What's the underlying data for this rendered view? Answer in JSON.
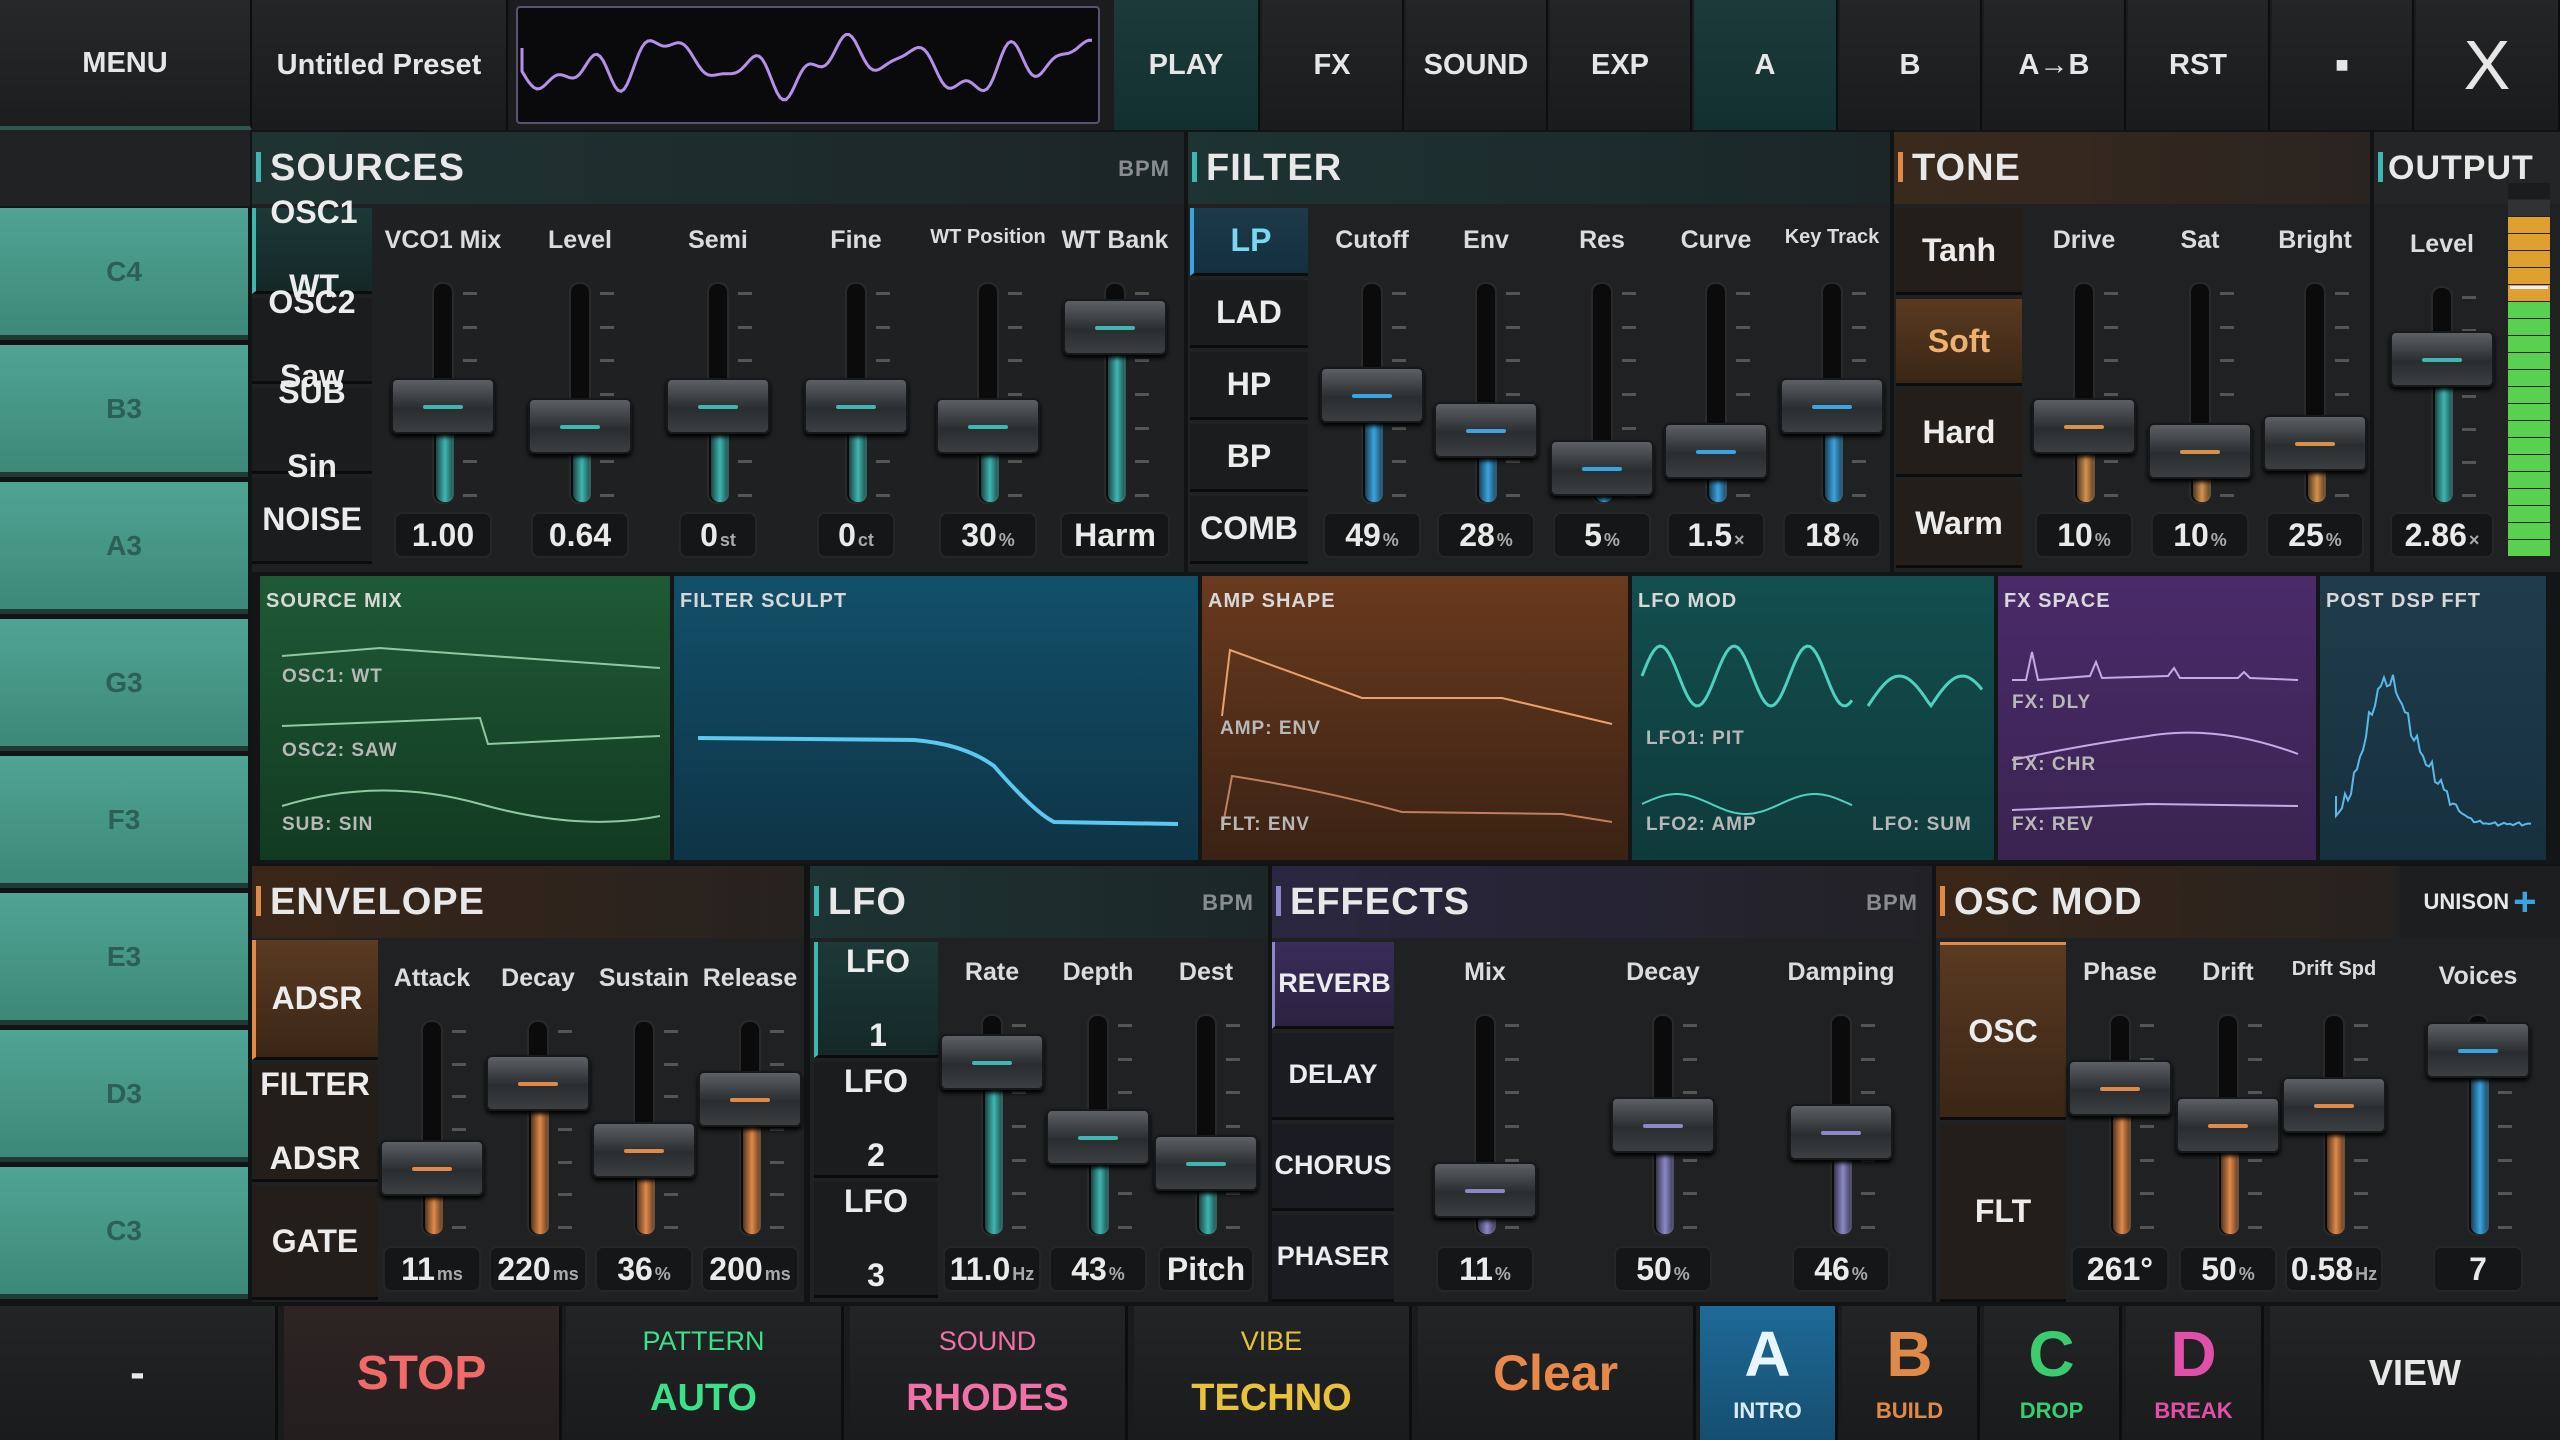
{
  "topbar": {
    "menu": "MENU",
    "preset": "Untitled Preset",
    "tabs": [
      "PLAY",
      "FX",
      "SOUND",
      "EXP",
      "A",
      "B",
      "A→B",
      "RST",
      "■"
    ],
    "close": "X"
  },
  "keys": [
    "C4",
    "B3",
    "A3",
    "G3",
    "F3",
    "E3",
    "D3",
    "C3"
  ],
  "sources": {
    "title": "SOURCES",
    "bpm": "BPM",
    "buttons": [
      {
        "l1": "OSC1",
        "l2": "WT"
      },
      {
        "l1": "OSC2",
        "l2": "Saw"
      },
      {
        "l1": "SUB",
        "l2": "Sin"
      },
      {
        "l1": "NOISE",
        "l2": ""
      }
    ],
    "labels": [
      "VCO1 Mix",
      "Level",
      "Semi",
      "Fine",
      "WT Position",
      "WT Bank"
    ],
    "values": [
      "1.00",
      "0.64",
      "0",
      "0",
      "30",
      "Harm"
    ],
    "units": [
      "",
      "",
      "st",
      "ct",
      "%",
      ""
    ],
    "levels": [
      0.42,
      0.3,
      0.42,
      0.42,
      0.3,
      0.9
    ]
  },
  "filter": {
    "title": "FILTER",
    "buttons": [
      "LP",
      "LAD",
      "HP",
      "BP",
      "COMB"
    ],
    "labels": [
      "Cutoff",
      "Env",
      "Res",
      "Curve",
      "Key Track"
    ],
    "values": [
      "49",
      "28",
      "5",
      "1.5",
      "18"
    ],
    "units": [
      "%",
      "%",
      "%",
      "×",
      "%"
    ],
    "levels": [
      0.49,
      0.28,
      0.05,
      0.15,
      0.42
    ]
  },
  "tone": {
    "title": "TONE",
    "buttons": [
      "Tanh",
      "Soft",
      "Hard",
      "Warm"
    ],
    "labels": [
      "Drive",
      "Sat",
      "Bright"
    ],
    "values": [
      "10",
      "10",
      "25"
    ],
    "units": [
      "%",
      "%",
      "%"
    ],
    "levels": [
      0.3,
      0.15,
      0.2
    ]
  },
  "output": {
    "title": "OUTPUT",
    "label": "Level",
    "value": "2.86",
    "unit": "×",
    "level": 0.72
  },
  "viz": {
    "source_mix": {
      "title": "SOURCE MIX",
      "labels": [
        "OSC1: WT",
        "OSC2: SAW",
        "SUB: SIN"
      ]
    },
    "filter_sculpt": {
      "title": "FILTER SCULPT"
    },
    "amp_shape": {
      "title": "AMP SHAPE",
      "labels": [
        "AMP: ENV",
        "FLT: ENV"
      ]
    },
    "lfo_mod": {
      "title": "LFO MOD",
      "labels": [
        "LFO1: PIT",
        "LFO2: AMP",
        "LFO: SUM"
      ]
    },
    "fx_space": {
      "title": "FX SPACE",
      "labels": [
        "FX: DLY",
        "FX: CHR",
        "FX: REV"
      ]
    },
    "post_dsp": {
      "title": "POST DSP FFT"
    }
  },
  "envelope": {
    "title": "ENVELOPE",
    "buttons": [
      {
        "l1": "ADSR",
        "l2": ""
      },
      {
        "l1": "FILTER",
        "l2": "ADSR"
      },
      {
        "l1": "GATE",
        "l2": ""
      }
    ],
    "labels": [
      "Attack",
      "Decay",
      "Sustain",
      "Release"
    ],
    "values": [
      "11",
      "220",
      "36",
      "200"
    ],
    "units": [
      "ms",
      "ms",
      "%",
      "ms"
    ],
    "levels": [
      0.25,
      0.78,
      0.36,
      0.68
    ]
  },
  "lfo": {
    "title": "LFO",
    "bpm": "BPM",
    "buttons": [
      {
        "l1": "LFO",
        "l2": "1"
      },
      {
        "l1": "LFO",
        "l2": "2"
      },
      {
        "l1": "LFO",
        "l2": "3"
      }
    ],
    "labels": [
      "Rate",
      "Depth",
      "Dest"
    ],
    "values": [
      "11.0",
      "43",
      "Pitch"
    ],
    "units": [
      "Hz",
      "%",
      ""
    ],
    "levels": [
      0.88,
      0.43,
      0.27
    ]
  },
  "effects": {
    "title": "EFFECTS",
    "bpm": "BPM",
    "buttons": [
      "REVERB",
      "DELAY",
      "CHORUS",
      "PHASER"
    ],
    "labels": [
      "Mix",
      "Decay",
      "Damping"
    ],
    "values": [
      "11",
      "50",
      "46"
    ],
    "units": [
      "%",
      "%",
      "%"
    ],
    "levels": [
      0.11,
      0.5,
      0.46
    ]
  },
  "oscmod": {
    "title": "OSC MOD",
    "unison": "UNISON",
    "buttons": [
      "OSC",
      "FLT"
    ],
    "labels": [
      "Phase",
      "Drift",
      "Drift Spd",
      "Voices"
    ],
    "values": [
      "261°",
      "50",
      "0.58",
      "7"
    ],
    "units": [
      "",
      "%",
      "Hz",
      ""
    ],
    "levels": [
      0.72,
      0.5,
      0.62,
      0.95
    ]
  },
  "bottom": {
    "minus": "-",
    "stop": "STOP",
    "pattern": {
      "top": "PATTERN",
      "main": "AUTO"
    },
    "sound": {
      "top": "SOUND",
      "main": "RHODES"
    },
    "vibe": {
      "top": "VIBE",
      "main": "TECHNO"
    },
    "clear": "Clear",
    "scenes": [
      {
        "letter": "A",
        "name": "INTRO"
      },
      {
        "letter": "B",
        "name": "BUILD"
      },
      {
        "letter": "C",
        "name": "DROP"
      },
      {
        "letter": "D",
        "name": "BREAK"
      }
    ],
    "view": "VIEW"
  },
  "colors": {
    "teal": "#3fb6b0",
    "orange": "#e08a4a",
    "tone_orange": "#d4924e",
    "lavender": "#8c88c8",
    "blue": "#3ba4e0",
    "stop_red": "#f06a6a",
    "auto_green": "#3ce08a",
    "rhodes_pink": "#f070a8",
    "techno_yellow": "#e8c23c",
    "clear_orange": "#e8884a"
  }
}
